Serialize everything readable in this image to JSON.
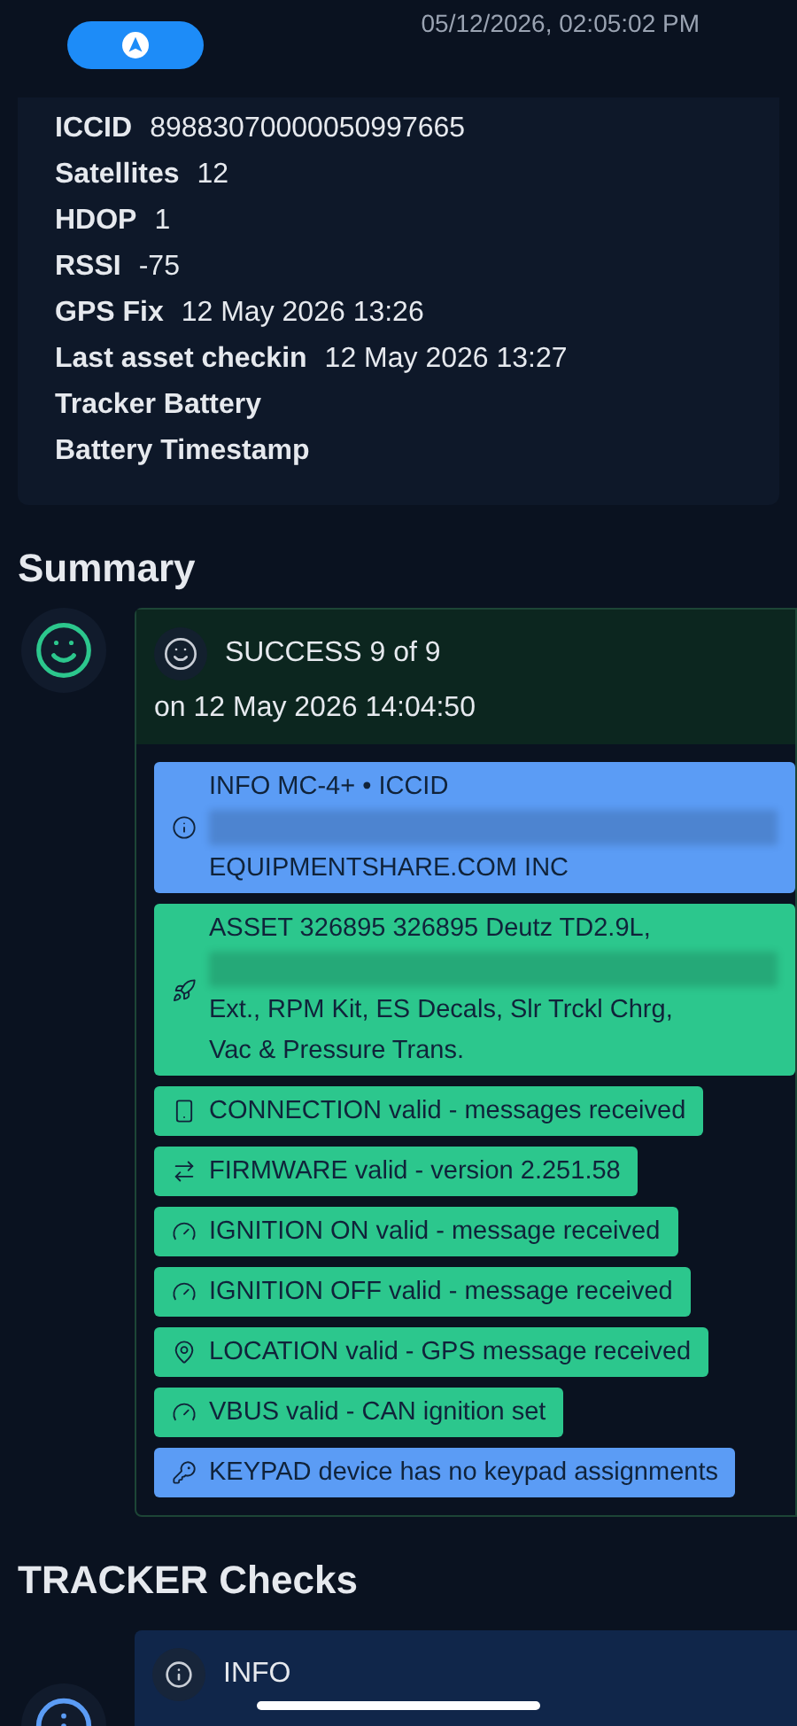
{
  "capture_timestamp": "05/12/2026, 02:05:02 PM",
  "details": [
    {
      "label": "ICCID",
      "value": "89883070000050997665"
    },
    {
      "label": "Satellites",
      "value": "12"
    },
    {
      "label": "HDOP",
      "value": "1"
    },
    {
      "label": "RSSI",
      "value": "-75"
    },
    {
      "label": "GPS Fix",
      "value": "12 May 2026 13:26"
    },
    {
      "label": "Last asset checkin",
      "value": "12 May 2026 13:27"
    },
    {
      "label": "Tracker Battery"
    },
    {
      "label": "Battery Timestamp"
    }
  ],
  "summary": {
    "heading": "Summary",
    "status": "SUCCESS 9 of 9",
    "date": "on 12 May 2026 14:04:50",
    "items": [
      {
        "kind": "info",
        "redacted": true,
        "lines": [
          "INFO MC-4+ • ICCID",
          "EQUIPMENTSHARE.COM INC"
        ]
      },
      {
        "kind": "success",
        "redacted": true,
        "lines": [
          "ASSET 326895 326895 Deutz TD2.9L,",
          "Ext., RPM Kit, ES Decals, Slr Trckl Chrg,",
          "Vac & Pressure Trans."
        ]
      },
      {
        "kind": "success",
        "redacted": false,
        "lines": [
          "CONNECTION valid - messages received"
        ]
      },
      {
        "kind": "success",
        "redacted": false,
        "lines": [
          "FIRMWARE valid - version 2.251.58"
        ]
      },
      {
        "kind": "success",
        "redacted": false,
        "lines": [
          "IGNITION ON valid - message received"
        ]
      },
      {
        "kind": "success",
        "redacted": false,
        "lines": [
          "IGNITION OFF valid - message received"
        ]
      },
      {
        "kind": "success",
        "redacted": false,
        "lines": [
          "LOCATION valid - GPS message received"
        ]
      },
      {
        "kind": "success",
        "redacted": false,
        "lines": [
          "VBUS valid - CAN ignition set"
        ]
      },
      {
        "kind": "info",
        "redacted": false,
        "lines": [
          "KEYPAD device has no keypad assignments"
        ]
      }
    ]
  },
  "tracker_checks": {
    "heading": "TRACKER Checks",
    "status": "INFO"
  }
}
